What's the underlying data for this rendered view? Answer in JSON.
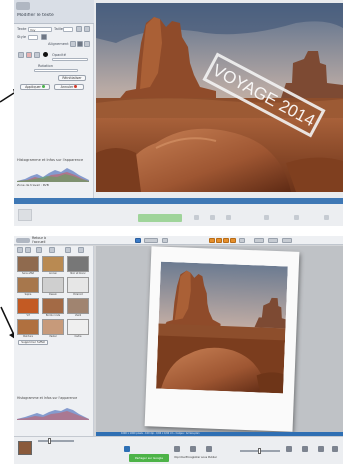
{
  "screen1": {
    "panel_title": "Modifier le texte",
    "field_label": "Texte :",
    "field_value": "Voy",
    "size_label": "Taille",
    "style_label": "Style",
    "align_label": "Alignement",
    "opacity_label": "Opacité",
    "rotation_label": "Rotation",
    "reset_label": "Réinitialiser",
    "apply_label": "Appliquer",
    "cancel_label": "Annuler",
    "histogram_label": "Histogramme et Infos sur l'apparence",
    "histogram_sub": "Zone de travail : RVB",
    "overlay_text": "VOYAGE 2014",
    "colors": {
      "accent": "#3f78b5",
      "apply": "#49b14a",
      "cancel": "#d33a2a"
    }
  },
  "screen2": {
    "top_title_line1": "Retour à",
    "top_title_line2": "l'accueil",
    "effects": [
      {
        "label": "Sans effet",
        "color": "#8f6a4e"
      },
      {
        "label": "Ancien",
        "color": "#b98a52"
      },
      {
        "label": "Noir et blanc",
        "color": "#777777"
      },
      {
        "label": "Sépia",
        "color": "#a7774c"
      },
      {
        "label": "Dessin",
        "color": "#cfcfcf"
      },
      {
        "label": "Polaroid",
        "color": "#e6e6e6"
      },
      {
        "label": "Vif",
        "color": "#c35a23"
      },
      {
        "label": "Bords ronds",
        "color": "#a36a45"
      },
      {
        "label": "Vieilli",
        "color": "#a08470"
      },
      {
        "label": "Peinture",
        "color": "#b0703f"
      },
      {
        "label": "Pastel",
        "color": "#c79a7a"
      },
      {
        "label": "Cadre",
        "color": "#efefef"
      }
    ],
    "remove_effect_label": "Supprimer l'effet",
    "histogram_label": "Histogramme et Infos sur l'apparence",
    "status_text": "1000 x 1000 pixels - 100 dpi - 0,84 x 0,84 cm - Calque : Arrière-plan",
    "bottom_labels": [
      "Imprimer",
      "Enregistrer sous",
      "Publier"
    ],
    "save_button_label": "Partager sur Google",
    "colors": {
      "accent": "#2f6fb3",
      "save": "#4db348"
    }
  }
}
